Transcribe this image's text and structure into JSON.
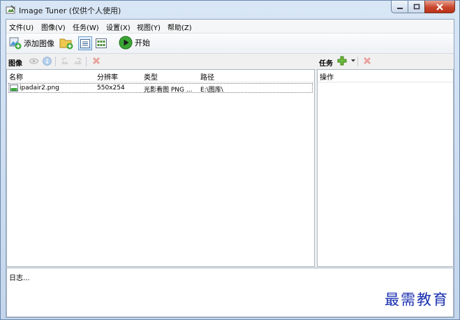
{
  "window": {
    "title": "Image Tuner (仅供个人使用)",
    "accent": "#c9472e"
  },
  "menu": [
    {
      "label": "文件(U)"
    },
    {
      "label": "图像(V)"
    },
    {
      "label": "任务(W)"
    },
    {
      "label": "设置(X)"
    },
    {
      "label": "视图(Y)"
    },
    {
      "label": "帮助(Z)"
    }
  ],
  "toolbar": {
    "add_image_label": "添加图像",
    "start_label": "开始"
  },
  "images_panel": {
    "title": "图像",
    "columns": [
      "名称",
      "分辨率",
      "类型",
      "路径"
    ],
    "rows": [
      {
        "name": "ipadair2.png",
        "resolution": "550x254",
        "type": "光影看图 PNG ...",
        "path": "E:\\图库\\"
      }
    ]
  },
  "tasks_panel": {
    "title": "任务",
    "column": "操作"
  },
  "log": {
    "label": "日志..."
  },
  "watermark": "最需教育"
}
